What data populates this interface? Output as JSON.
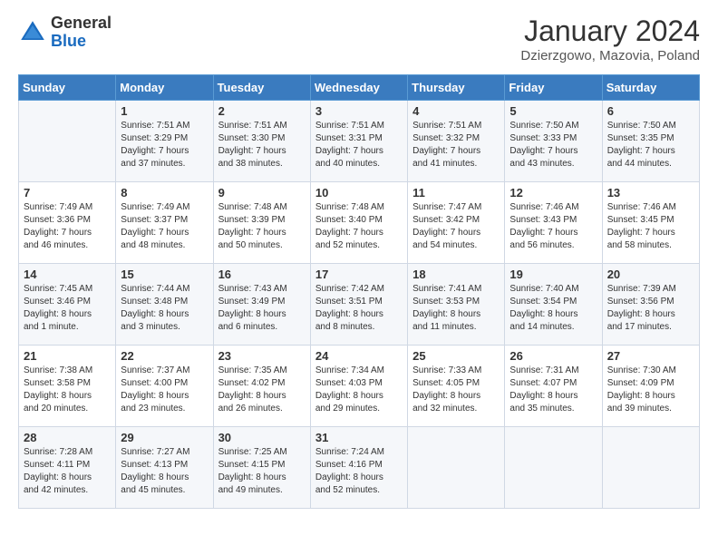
{
  "logo": {
    "general": "General",
    "blue": "Blue"
  },
  "header": {
    "month": "January 2024",
    "location": "Dzierzgowo, Mazovia, Poland"
  },
  "days_of_week": [
    "Sunday",
    "Monday",
    "Tuesday",
    "Wednesday",
    "Thursday",
    "Friday",
    "Saturday"
  ],
  "weeks": [
    [
      {
        "num": "",
        "info": ""
      },
      {
        "num": "1",
        "info": "Sunrise: 7:51 AM\nSunset: 3:29 PM\nDaylight: 7 hours\nand 37 minutes."
      },
      {
        "num": "2",
        "info": "Sunrise: 7:51 AM\nSunset: 3:30 PM\nDaylight: 7 hours\nand 38 minutes."
      },
      {
        "num": "3",
        "info": "Sunrise: 7:51 AM\nSunset: 3:31 PM\nDaylight: 7 hours\nand 40 minutes."
      },
      {
        "num": "4",
        "info": "Sunrise: 7:51 AM\nSunset: 3:32 PM\nDaylight: 7 hours\nand 41 minutes."
      },
      {
        "num": "5",
        "info": "Sunrise: 7:50 AM\nSunset: 3:33 PM\nDaylight: 7 hours\nand 43 minutes."
      },
      {
        "num": "6",
        "info": "Sunrise: 7:50 AM\nSunset: 3:35 PM\nDaylight: 7 hours\nand 44 minutes."
      }
    ],
    [
      {
        "num": "7",
        "info": "Sunrise: 7:49 AM\nSunset: 3:36 PM\nDaylight: 7 hours\nand 46 minutes."
      },
      {
        "num": "8",
        "info": "Sunrise: 7:49 AM\nSunset: 3:37 PM\nDaylight: 7 hours\nand 48 minutes."
      },
      {
        "num": "9",
        "info": "Sunrise: 7:48 AM\nSunset: 3:39 PM\nDaylight: 7 hours\nand 50 minutes."
      },
      {
        "num": "10",
        "info": "Sunrise: 7:48 AM\nSunset: 3:40 PM\nDaylight: 7 hours\nand 52 minutes."
      },
      {
        "num": "11",
        "info": "Sunrise: 7:47 AM\nSunset: 3:42 PM\nDaylight: 7 hours\nand 54 minutes."
      },
      {
        "num": "12",
        "info": "Sunrise: 7:46 AM\nSunset: 3:43 PM\nDaylight: 7 hours\nand 56 minutes."
      },
      {
        "num": "13",
        "info": "Sunrise: 7:46 AM\nSunset: 3:45 PM\nDaylight: 7 hours\nand 58 minutes."
      }
    ],
    [
      {
        "num": "14",
        "info": "Sunrise: 7:45 AM\nSunset: 3:46 PM\nDaylight: 8 hours\nand 1 minute."
      },
      {
        "num": "15",
        "info": "Sunrise: 7:44 AM\nSunset: 3:48 PM\nDaylight: 8 hours\nand 3 minutes."
      },
      {
        "num": "16",
        "info": "Sunrise: 7:43 AM\nSunset: 3:49 PM\nDaylight: 8 hours\nand 6 minutes."
      },
      {
        "num": "17",
        "info": "Sunrise: 7:42 AM\nSunset: 3:51 PM\nDaylight: 8 hours\nand 8 minutes."
      },
      {
        "num": "18",
        "info": "Sunrise: 7:41 AM\nSunset: 3:53 PM\nDaylight: 8 hours\nand 11 minutes."
      },
      {
        "num": "19",
        "info": "Sunrise: 7:40 AM\nSunset: 3:54 PM\nDaylight: 8 hours\nand 14 minutes."
      },
      {
        "num": "20",
        "info": "Sunrise: 7:39 AM\nSunset: 3:56 PM\nDaylight: 8 hours\nand 17 minutes."
      }
    ],
    [
      {
        "num": "21",
        "info": "Sunrise: 7:38 AM\nSunset: 3:58 PM\nDaylight: 8 hours\nand 20 minutes."
      },
      {
        "num": "22",
        "info": "Sunrise: 7:37 AM\nSunset: 4:00 PM\nDaylight: 8 hours\nand 23 minutes."
      },
      {
        "num": "23",
        "info": "Sunrise: 7:35 AM\nSunset: 4:02 PM\nDaylight: 8 hours\nand 26 minutes."
      },
      {
        "num": "24",
        "info": "Sunrise: 7:34 AM\nSunset: 4:03 PM\nDaylight: 8 hours\nand 29 minutes."
      },
      {
        "num": "25",
        "info": "Sunrise: 7:33 AM\nSunset: 4:05 PM\nDaylight: 8 hours\nand 32 minutes."
      },
      {
        "num": "26",
        "info": "Sunrise: 7:31 AM\nSunset: 4:07 PM\nDaylight: 8 hours\nand 35 minutes."
      },
      {
        "num": "27",
        "info": "Sunrise: 7:30 AM\nSunset: 4:09 PM\nDaylight: 8 hours\nand 39 minutes."
      }
    ],
    [
      {
        "num": "28",
        "info": "Sunrise: 7:28 AM\nSunset: 4:11 PM\nDaylight: 8 hours\nand 42 minutes."
      },
      {
        "num": "29",
        "info": "Sunrise: 7:27 AM\nSunset: 4:13 PM\nDaylight: 8 hours\nand 45 minutes."
      },
      {
        "num": "30",
        "info": "Sunrise: 7:25 AM\nSunset: 4:15 PM\nDaylight: 8 hours\nand 49 minutes."
      },
      {
        "num": "31",
        "info": "Sunrise: 7:24 AM\nSunset: 4:16 PM\nDaylight: 8 hours\nand 52 minutes."
      },
      {
        "num": "",
        "info": ""
      },
      {
        "num": "",
        "info": ""
      },
      {
        "num": "",
        "info": ""
      }
    ]
  ]
}
